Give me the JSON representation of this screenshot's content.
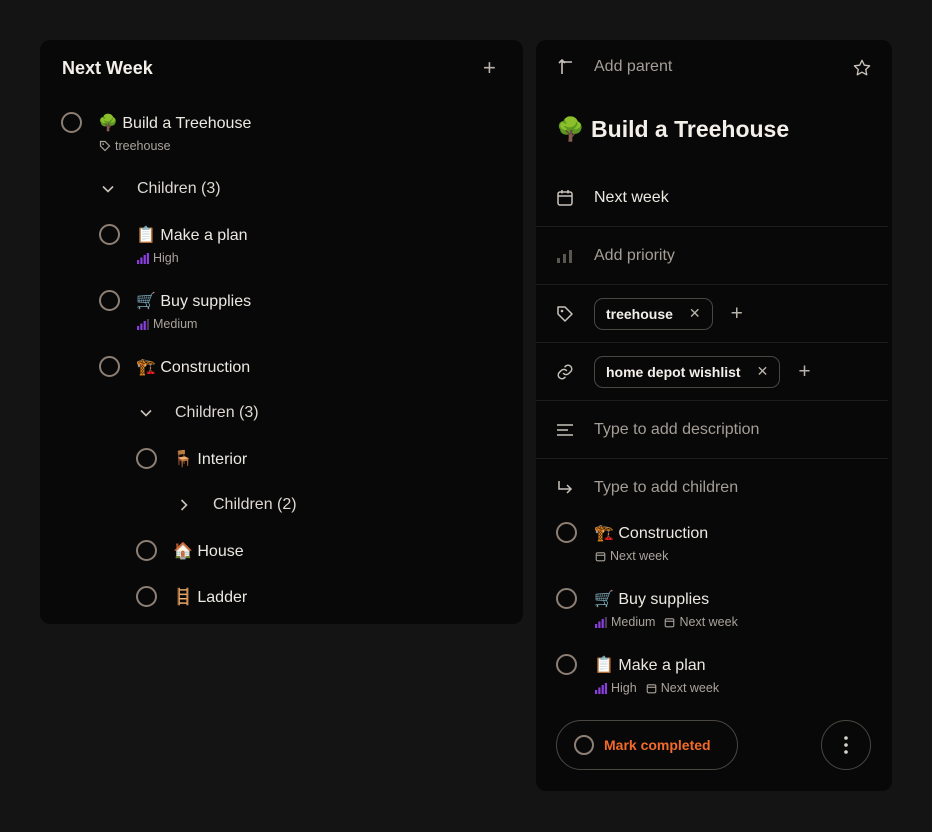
{
  "left": {
    "title": "Next Week",
    "root": {
      "emoji": "🌳",
      "title": "Build a Treehouse",
      "tag": "treehouse"
    },
    "children_label": "Children (3)",
    "children": [
      {
        "emoji": "📋",
        "title": "Make a plan",
        "priority": "High"
      },
      {
        "emoji": "🛒",
        "title": "Buy supplies",
        "priority": "Medium"
      },
      {
        "emoji": "🏗️",
        "title": "Construction"
      }
    ],
    "construction_children_label": "Children (3)",
    "construction_children": [
      {
        "emoji": "🪑",
        "title": "Interior",
        "children_label": "Children (2)"
      },
      {
        "emoji": "🏠",
        "title": "House"
      },
      {
        "emoji": "🪜",
        "title": "Ladder"
      }
    ]
  },
  "right": {
    "add_parent": "Add parent",
    "title_emoji": "🌳",
    "title": "Build a Treehouse",
    "date": "Next week",
    "priority_placeholder": "Add priority",
    "tags": [
      "treehouse"
    ],
    "links": [
      "home depot wishlist"
    ],
    "description_placeholder": "Type to add description",
    "children_placeholder": "Type to add children",
    "children": [
      {
        "emoji": "🏗️",
        "title": "Construction",
        "date": "Next week"
      },
      {
        "emoji": "🛒",
        "title": "Buy supplies",
        "priority": "Medium",
        "date": "Next week"
      },
      {
        "emoji": "📋",
        "title": "Make a plan",
        "priority": "High",
        "date": "Next week"
      }
    ],
    "mark_completed": "Mark completed"
  },
  "colors": {
    "accent_orange": "#f36a2a",
    "priority_purple": "#8b3fe0",
    "circle_border": "#8d7f74"
  }
}
